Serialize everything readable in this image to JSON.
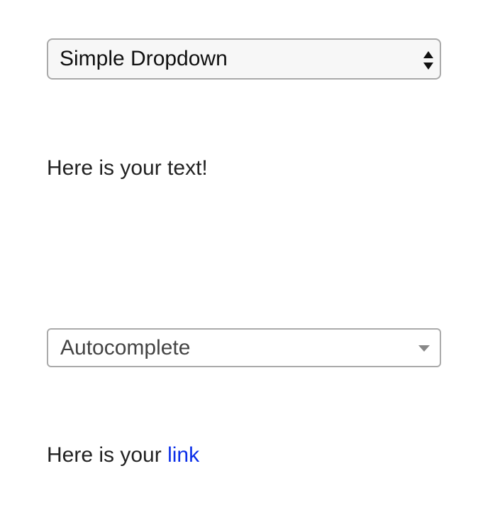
{
  "simple_dropdown": {
    "selected_value": "Simple Dropdown"
  },
  "text_block": {
    "text": "Here is your text!"
  },
  "autocomplete": {
    "selected_value": "Autocomplete"
  },
  "link_line": {
    "prefix": "Here is your ",
    "link_text": "link"
  },
  "colors": {
    "link": "#0a2ee8",
    "text": "#222222",
    "border": "#a9a9a9"
  },
  "icons": {
    "dropdown": "up-down-stepper-icon",
    "autocomplete": "caret-down-icon"
  }
}
